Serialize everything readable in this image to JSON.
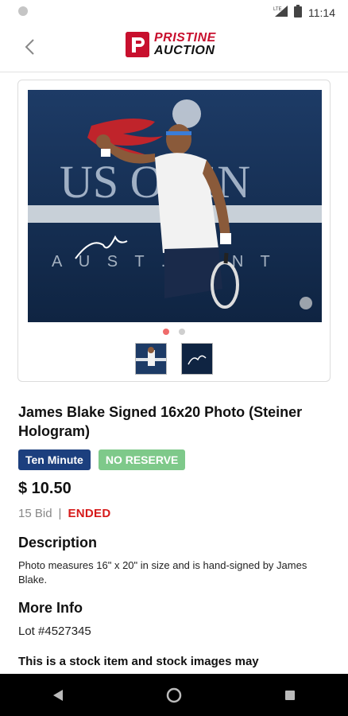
{
  "status_bar": {
    "time": "11:14",
    "network": "LTE"
  },
  "app": {
    "logo_line1": "PRISTINE",
    "logo_line2": "AUCTION",
    "logo_mark": "P"
  },
  "gallery": {
    "image_banner_text": "US OPEN",
    "image_overlay_text": "A U S T ... E N T"
  },
  "product": {
    "title": "James Blake Signed 16x20 Photo (Steiner Hologram)",
    "badges": [
      "Ten Minute",
      "NO RESERVE"
    ],
    "price": "$ 10.50",
    "bids": "15 Bid",
    "separator": "|",
    "status": "ENDED"
  },
  "description": {
    "heading": "Description",
    "text": "Photo measures 16\" x 20\" in size and is hand-signed by James Blake."
  },
  "more_info": {
    "heading": "More Info",
    "lot": "Lot #4527345"
  },
  "stock_note": "This is a stock item and stock images may",
  "colors": {
    "brand_red": "#c8102e",
    "badge_blue": "#1c3f7e",
    "badge_green": "#7ec98a",
    "ended_red": "#d61a1a"
  }
}
